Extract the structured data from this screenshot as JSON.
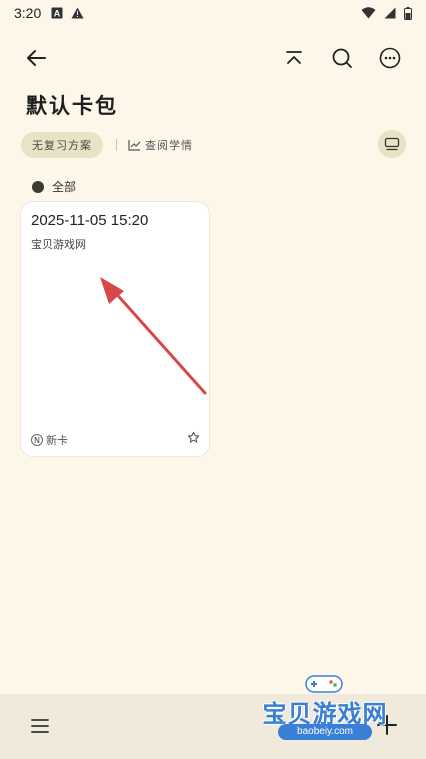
{
  "status_bar": {
    "time": "3:20",
    "icons_left": [
      "A-icon",
      "warning-icon"
    ],
    "icons_right": [
      "wifi-icon",
      "signal-icon",
      "battery-icon"
    ]
  },
  "toolbar": {
    "back_icon": "arrow-left-icon",
    "scroll_top_icon": "scroll-top-icon",
    "search_icon": "search-icon",
    "more_icon": "more-horizontal-icon"
  },
  "page": {
    "title": "默认卡包"
  },
  "filters": {
    "review_plan_label": "无复习方案",
    "study_stats_label": "查阅学情",
    "all_label": "全部"
  },
  "cards": [
    {
      "date": "2025-11-05 15:20",
      "text": "宝贝游戏网",
      "type_label": "新卡",
      "type_badge": "N"
    }
  ],
  "watermark": {
    "title": "宝贝游戏网",
    "url": "baobeiy.com"
  },
  "colors": {
    "background": "#fcf7e9",
    "chip_bg": "#e6e3c6",
    "card_bg": "#ffffff",
    "bottom_bar": "#efeadc",
    "arrow": "#d94848"
  }
}
